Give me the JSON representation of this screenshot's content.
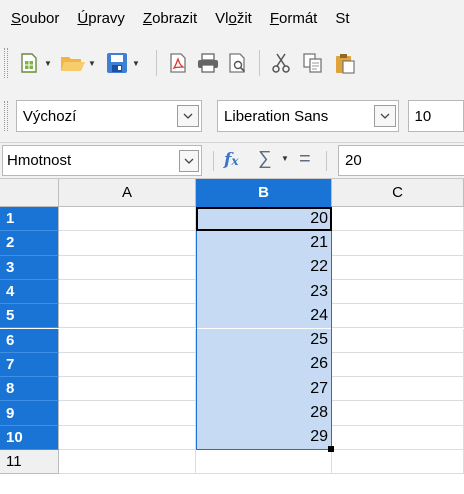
{
  "menu": [
    {
      "accel": "S",
      "rest": "oubor"
    },
    {
      "accel": "Ú",
      "rest": "pravy"
    },
    {
      "accel": "Z",
      "rest": "obrazit"
    },
    {
      "accel": "",
      "rest": "Vl",
      "accel2": "o",
      "rest2": "žit"
    },
    {
      "accel": "F",
      "rest": "ormát"
    },
    {
      "accel": "",
      "rest": "St"
    }
  ],
  "toolbar": {
    "icons": [
      "new-document-icon",
      "open-folder-icon",
      "save-icon",
      "export-pdf-icon",
      "print-icon",
      "print-preview-icon",
      "cut-icon",
      "copy-icon",
      "paste-icon"
    ]
  },
  "format": {
    "style": "Výchozí",
    "font": "Liberation Sans",
    "size": "10"
  },
  "formula": {
    "name_box": "Hmotnost",
    "content": "20",
    "fx": "f",
    "fx_sub": "x",
    "sum": "∑",
    "eq": "="
  },
  "columns": [
    "A",
    "B",
    "C"
  ],
  "rows": [
    "1",
    "2",
    "3",
    "4",
    "5",
    "6",
    "7",
    "8",
    "9",
    "10",
    "11"
  ],
  "column_b_values": [
    "20",
    "21",
    "22",
    "23",
    "24",
    "25",
    "26",
    "27",
    "28",
    "29",
    ""
  ],
  "colors": {
    "selection_header": "#1a74d6",
    "selection_fill": "#c6dbf3"
  }
}
